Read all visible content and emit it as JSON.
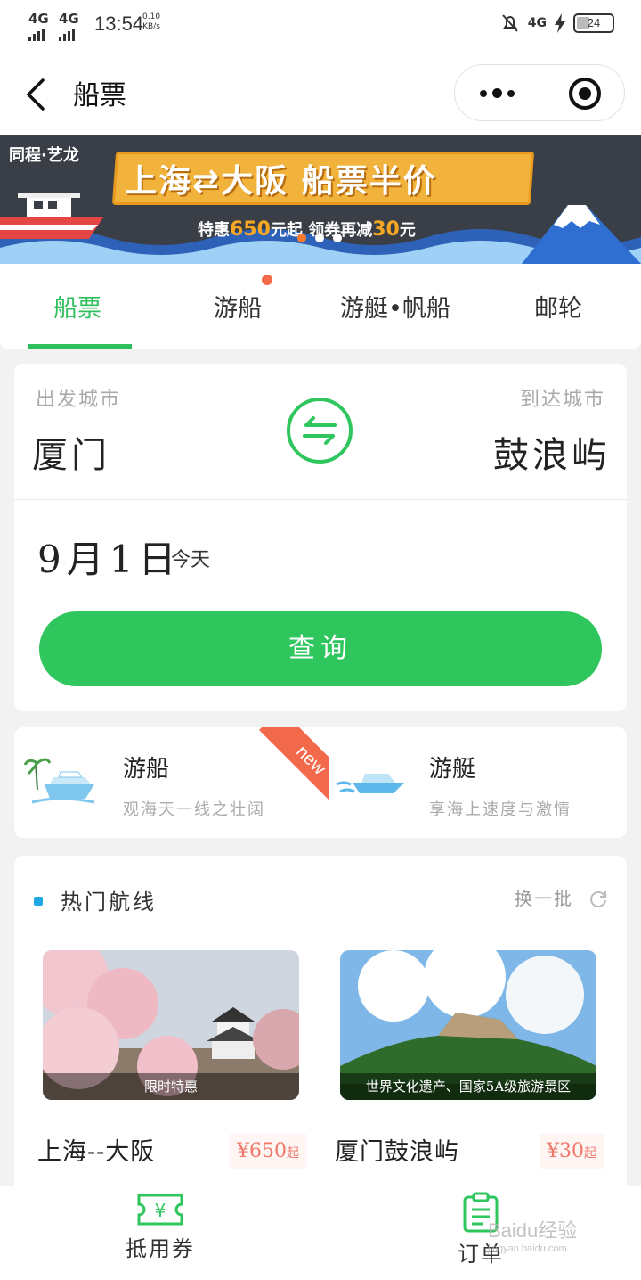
{
  "status_bar": {
    "signal1": "4G",
    "signal2": "4G",
    "time": "13:54",
    "speed_value": "0.10",
    "speed_unit": "KB/s",
    "network": "4G",
    "battery": "24"
  },
  "nav": {
    "title": "船票"
  },
  "banner": {
    "brand": "同程·艺龙",
    "headline": "上海⇄大阪 船票半价",
    "sub_prefix": "特惠",
    "sub_price": "650",
    "sub_mid": "元起 领券再减",
    "sub_discount": "30",
    "sub_suffix": "元"
  },
  "tabs": [
    {
      "label": "船票"
    },
    {
      "label": "游船"
    },
    {
      "label": "游艇•帆船"
    },
    {
      "label": "邮轮"
    }
  ],
  "search": {
    "from_label": "出发城市",
    "to_label": "到达城市",
    "from_city": "厦门",
    "to_city": "鼓浪屿",
    "date": "9月1日",
    "date_note": "今天",
    "query_label": "查询"
  },
  "features": [
    {
      "title": "游船",
      "subtitle": "观海天一线之壮阔",
      "badge": "new"
    },
    {
      "title": "游艇",
      "subtitle": "享海上速度与激情"
    }
  ],
  "hot_routes": {
    "title": "热门航线",
    "refresh_label": "换一批",
    "routes": [
      {
        "caption": "限时特惠",
        "name": "上海--大阪",
        "price": "¥650",
        "price_suffix": "起"
      },
      {
        "caption": "世界文化遗产、国家5A级旅游景区",
        "name": "厦门鼓浪屿",
        "price": "¥30",
        "price_suffix": "起"
      }
    ]
  },
  "bottom_bar": {
    "coupon_label": "抵用券",
    "orders_label": "订单"
  },
  "watermark": {
    "text": "Baidu经验",
    "url": "jingyan.baidu.com"
  },
  "colors": {
    "accent": "#2fc65e",
    "badge": "#f26a4b",
    "price": "#f0786a",
    "marker": "#1fa8e6"
  }
}
